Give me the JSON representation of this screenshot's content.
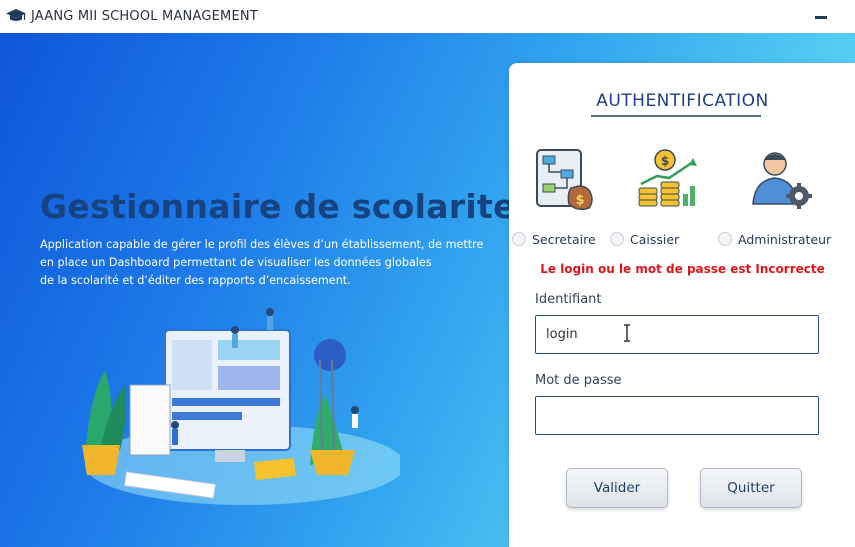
{
  "app": {
    "title": "JAANG MII SCHOOL MANAGEMENT",
    "title_icon": "graduation-cap-icon",
    "minimize_icon": "minimize-icon"
  },
  "hero": {
    "title": "Gestionnaire de scolarite",
    "description_lines": [
      "Application capable de gérer le profil des élèves d’un établissement, de mettre",
      "en place un Dashboard permettant de visualiser les données globales",
      "de la scolarité et d’éditer des rapports d’encaissement."
    ],
    "illustration": "dashboard-illustration"
  },
  "auth": {
    "title": "AUTHENTIFICATION",
    "roles": [
      {
        "label": "Secretaire",
        "icon": "workflow-money-bag-icon",
        "selected": false
      },
      {
        "label": "Caissier",
        "icon": "coins-growth-chart-icon",
        "selected": false
      },
      {
        "label": "Administrateur",
        "icon": "user-gear-icon",
        "selected": false
      }
    ],
    "error_message": "Le login ou le mot de passe est Incorrecte",
    "identifiant": {
      "label": "Identifiant",
      "value": "login"
    },
    "password": {
      "label": "Mot de passe",
      "value": ""
    },
    "buttons": {
      "submit": "Valider",
      "quit": "Quitter"
    }
  },
  "colors": {
    "title": "#16427f",
    "error": "#e0151a",
    "accent": "#1f4f86"
  }
}
